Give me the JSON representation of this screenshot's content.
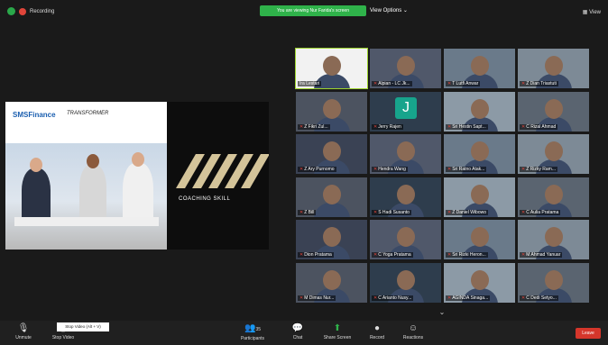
{
  "topbar": {
    "recording_label": "Recording",
    "share_banner": "You are viewing Nur Farida's screen",
    "view_options": "View Options",
    "view_label": "View"
  },
  "slide": {
    "logo_left": "SMSFinance",
    "logo_right": "TRANSFORMER",
    "title": "COACHING SKILL"
  },
  "participants": [
    {
      "name": "Ira Lestari",
      "active": true
    },
    {
      "name": "Alpian - LC Jk..."
    },
    {
      "name": "T Lutfi Anwar"
    },
    {
      "name": "Z Dian Triastuti"
    },
    {
      "name": "Z Fikri Zul..."
    },
    {
      "name": "Jerry Rajen",
      "avatar": "J"
    },
    {
      "name": "Sri Hestin Sapt..."
    },
    {
      "name": "C Rizal Ahmad"
    },
    {
      "name": "Z Ary Purnomo"
    },
    {
      "name": "Hendra Wang"
    },
    {
      "name": "Sri Ratno Atak..."
    },
    {
      "name": "Z Rizky Ram..."
    },
    {
      "name": "Z Bill"
    },
    {
      "name": "S Hadi Susanto"
    },
    {
      "name": "Z Daniel Wibowo"
    },
    {
      "name": "C Aulia Pratama"
    },
    {
      "name": "Dion Pratama"
    },
    {
      "name": "C Yoga Pratama"
    },
    {
      "name": "Sri Rizki Heron..."
    },
    {
      "name": "M Ahmad Yanuar"
    },
    {
      "name": "M Dimas Nur..."
    },
    {
      "name": "C Arianto Nusy..."
    },
    {
      "name": "AGINDA Sinaga..."
    },
    {
      "name": "C Dedi Setyo..."
    }
  ],
  "toolbar": {
    "unmute": "Unmute",
    "stop_video": "Stop Video",
    "stop_video_tooltip": "Stop Video (Alt + V)",
    "participants": "Participants",
    "participants_count": "35",
    "chat": "Chat",
    "share_screen": "Share Screen",
    "record": "Record",
    "reactions": "Reactions",
    "leave": "Leave"
  },
  "colors": {
    "share_green": "#2fb24a",
    "active_speaker": "#9dd32e",
    "leave_red": "#d5362b",
    "muted_red": "#e0453a"
  }
}
